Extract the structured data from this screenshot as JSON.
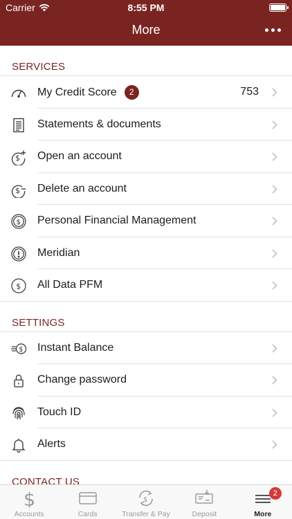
{
  "status_bar": {
    "carrier": "Carrier",
    "time": "8:55 PM"
  },
  "nav": {
    "title": "More"
  },
  "services": {
    "title": "SERVICES",
    "items": [
      {
        "label": "My Credit Score",
        "badge": "2",
        "value": "753",
        "icon": "speedometer-icon"
      },
      {
        "label": "Statements & documents",
        "icon": "document-icon"
      },
      {
        "label": "Open an account",
        "icon": "dollar-plus-icon"
      },
      {
        "label": "Delete an account",
        "icon": "dollar-minus-icon"
      },
      {
        "label": "Personal Financial Management",
        "icon": "dollar-circle-icon"
      },
      {
        "label": "Meridian",
        "icon": "info-circle-icon"
      },
      {
        "label": "All Data PFM",
        "icon": "dollar-circle-icon"
      }
    ]
  },
  "settings": {
    "title": "SETTINGS",
    "items": [
      {
        "label": "Instant Balance",
        "icon": "fast-dollar-icon"
      },
      {
        "label": "Change password",
        "icon": "lock-icon"
      },
      {
        "label": "Touch ID",
        "icon": "fingerprint-icon"
      },
      {
        "label": "Alerts",
        "icon": "bell-icon"
      }
    ]
  },
  "contact": {
    "title": "CONTACT US"
  },
  "tabbar": {
    "tabs": [
      {
        "label": "Accounts",
        "icon": "dollar-icon"
      },
      {
        "label": "Cards",
        "icon": "card-icon"
      },
      {
        "label": "Transfer & Pay",
        "icon": "transfer-icon"
      },
      {
        "label": "Deposit",
        "icon": "check-deposit-icon"
      },
      {
        "label": "More",
        "icon": "menu-icon",
        "badge": "2",
        "active": true
      }
    ]
  },
  "colors": {
    "brand": "#7a2422",
    "badge_red": "#d33a36",
    "inactive": "#9a9a9a"
  }
}
